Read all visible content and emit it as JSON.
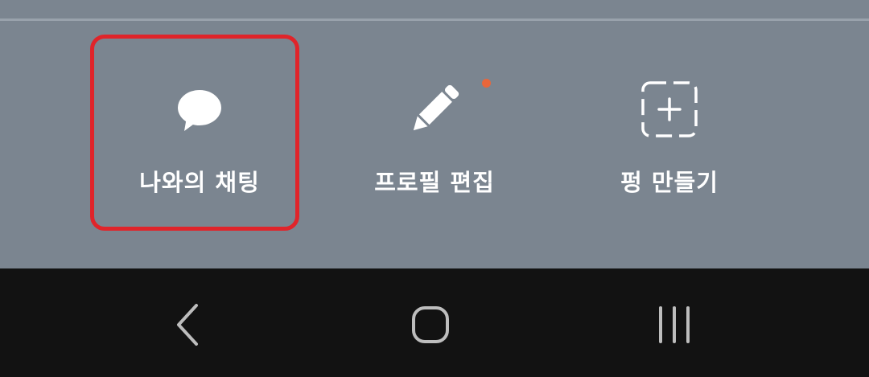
{
  "actions": [
    {
      "label": "나와의 채팅",
      "icon": "chat-bubble-icon"
    },
    {
      "label": "프로필 편집",
      "icon": "pencil-icon"
    },
    {
      "label": "펑 만들기",
      "icon": "dashed-plus-icon"
    }
  ],
  "notification_dot_color": "#e8663b",
  "highlight_color": "#e0242a",
  "nav": {
    "back": "back-icon",
    "home": "home-icon",
    "recents": "recents-icon"
  }
}
